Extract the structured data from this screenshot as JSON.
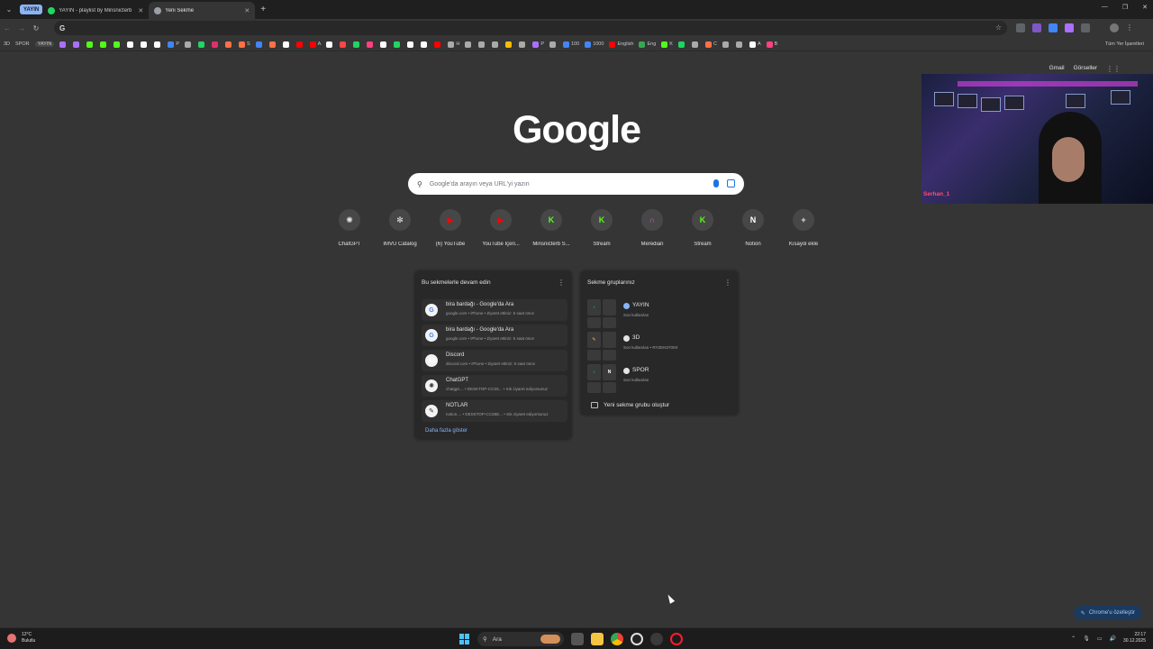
{
  "tabs": {
    "group_label": "YAYIN",
    "items": [
      {
        "label": "YAYIN - playlist by Minsnicterb",
        "color": "#1ed760"
      },
      {
        "label": "Yeni Sekme",
        "color": "#9aa0a6"
      }
    ]
  },
  "toolbar": {
    "omni_g": "G"
  },
  "bookmarks": {
    "chips": [
      "3D",
      "SPOR",
      "YAYIN"
    ],
    "items": [
      {
        "label": "",
        "color": "#a970ff"
      },
      {
        "label": "",
        "color": "#a970ff"
      },
      {
        "label": "",
        "color": "#53fc18"
      },
      {
        "label": "",
        "color": "#53fc18"
      },
      {
        "label": "",
        "color": "#53fc18"
      },
      {
        "label": "",
        "color": "#ffffff"
      },
      {
        "label": "",
        "color": "#ffffff"
      },
      {
        "label": "",
        "color": "#ffffff"
      },
      {
        "label": "P",
        "color": "#4285f4"
      },
      {
        "label": "",
        "color": "#aaaaaa"
      },
      {
        "label": "",
        "color": "#25d366"
      },
      {
        "label": "",
        "color": "#e1306c"
      },
      {
        "label": "",
        "color": "#ff7043"
      },
      {
        "label": "S",
        "color": "#ff7043"
      },
      {
        "label": "",
        "color": "#4285f4"
      },
      {
        "label": "",
        "color": "#ff7043"
      },
      {
        "label": "",
        "color": "#ffffff"
      },
      {
        "label": "",
        "color": "#ff0000"
      },
      {
        "label": "A",
        "color": "#ff0000"
      },
      {
        "label": "",
        "color": "#ffffff"
      },
      {
        "label": "",
        "color": "#ff4444"
      },
      {
        "label": "",
        "color": "#1ed760"
      },
      {
        "label": "",
        "color": "#ff4081"
      },
      {
        "label": "",
        "color": "#ffffff"
      },
      {
        "label": "",
        "color": "#1ed760"
      },
      {
        "label": "",
        "color": "#ffffff"
      },
      {
        "label": "",
        "color": "#ffffff"
      },
      {
        "label": "",
        "color": "#ff0000"
      },
      {
        "label": "H",
        "color": "#aaaaaa"
      },
      {
        "label": "",
        "color": "#aaaaaa"
      },
      {
        "label": "",
        "color": "#aaaaaa"
      },
      {
        "label": "",
        "color": "#aaaaaa"
      },
      {
        "label": "",
        "color": "#fbbc04"
      },
      {
        "label": "",
        "color": "#aaaaaa"
      },
      {
        "label": "P",
        "color": "#a970ff"
      },
      {
        "label": "",
        "color": "#aaaaaa"
      },
      {
        "label": "100",
        "color": "#4285f4"
      },
      {
        "label": "1000",
        "color": "#4285f4"
      },
      {
        "label": "English",
        "color": "#ff0000"
      },
      {
        "label": "Eng",
        "color": "#34a853"
      },
      {
        "label": "K",
        "color": "#53fc18"
      },
      {
        "label": "",
        "color": "#1ed760"
      },
      {
        "label": "",
        "color": "#aaaaaa"
      },
      {
        "label": "C",
        "color": "#ff7043"
      },
      {
        "label": "",
        "color": "#aaaaaa"
      },
      {
        "label": "",
        "color": "#aaaaaa"
      },
      {
        "label": "A",
        "color": "#ffffff"
      },
      {
        "label": "B",
        "color": "#ff4081"
      }
    ],
    "all_bookmarks": "Tüm Yer İşaretleri"
  },
  "toplinks": {
    "gmail": "Gmail",
    "images": "Görseller"
  },
  "webcam": {
    "chat": "Serhan_1"
  },
  "logo": "Google",
  "search": {
    "placeholder": "Google'da arayın veya URL'yi yazın"
  },
  "shortcuts": [
    {
      "label": "ChatGPT",
      "glyph": "✺",
      "color": "#e3e3e3"
    },
    {
      "label": "IMVU Catalog",
      "glyph": "✻",
      "color": "#e3e3e3"
    },
    {
      "label": "(6) YouTube",
      "glyph": "▶",
      "color": "#ff0000"
    },
    {
      "label": "YouTube İçeri...",
      "glyph": "▶",
      "color": "#ff0000"
    },
    {
      "label": "Minsnicterb S...",
      "glyph": "K",
      "color": "#53fc18"
    },
    {
      "label": "Stream",
      "glyph": "K",
      "color": "#53fc18"
    },
    {
      "label": "Meredian",
      "glyph": "∩",
      "color": "#e056c6"
    },
    {
      "label": "Stream",
      "glyph": "K",
      "color": "#53fc18"
    },
    {
      "label": "Notion",
      "glyph": "N",
      "color": "#ffffff"
    },
    {
      "label": "Kısayol ekle",
      "glyph": "+",
      "color": "#e3e3e3"
    }
  ],
  "resume": {
    "title": "Bu sekmelerle devam edin",
    "rows": [
      {
        "title": "bira bardağı - Google'da Ara",
        "sub": "google.com • iPhone • Ziyaret ettiniz: 5 saat önce",
        "glyph": "G",
        "color": "#4285f4"
      },
      {
        "title": "bira bardağı - Google'da Ara",
        "sub": "google.com • iPhone • Ziyaret ettiniz: 5 saat önce",
        "glyph": "G",
        "color": "#4285f4"
      },
      {
        "title": "Discord",
        "sub": "discord.com • iPhone • Ziyaret ettiniz: 5 saat önce",
        "glyph": "43",
        "color": "#ffffff"
      },
      {
        "title": "ChatGPT",
        "sub": "chatgpt.... • DESKTOP-CCS5... • Sık ziyaret ediyorsunuz",
        "glyph": "✺",
        "color": "#333333"
      },
      {
        "title": "NOTLAR",
        "sub": "notion.... • DESKTOP-CCS5E... • Sık ziyaret ediyorsunuz",
        "glyph": "✎",
        "color": "#333333"
      }
    ],
    "more": "Daha fazla göster"
  },
  "groups": {
    "title": "Sekme gruplarınız",
    "rows": [
      {
        "name": "YAYIN",
        "sub": "Son kullanılan",
        "dot": "#8ab4f8"
      },
      {
        "name": "3D",
        "sub": "Son kullanılan • RYZEN3700X",
        "dot": "#e3e3e3"
      },
      {
        "name": "SPOR",
        "sub": "Son kullanılan",
        "dot": "#e3e3e3"
      }
    ],
    "new_group": "Yeni sekme grubu oluştur"
  },
  "customize": "Chrome'u özelleştir",
  "taskbar": {
    "temp": "12°C",
    "weather": "Bulutlu",
    "search": "Ara",
    "time": "22:17",
    "date": "30.12.2025"
  }
}
